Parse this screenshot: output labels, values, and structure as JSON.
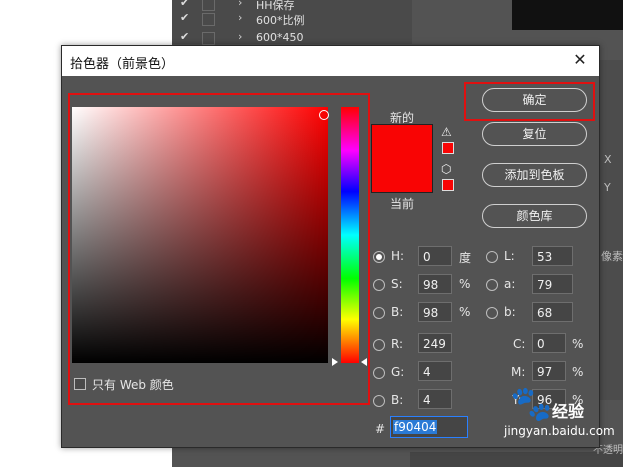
{
  "background": {
    "rows": [
      {
        "label": "HH保存",
        "check": "✔"
      },
      {
        "label": "600*比例",
        "check": "✔"
      },
      {
        "label": "600*450",
        "check": "✔"
      }
    ],
    "side_labels": {
      "x": "X",
      "y": "Y",
      "pixel": "像素",
      "opacity": "不透明"
    }
  },
  "dialog": {
    "title": "拾色器（前景色）",
    "close_glyph": "✕",
    "web_only_label": "只有 Web 颜色",
    "new_label": "新的",
    "current_label": "当前",
    "buttons": {
      "ok": "确定",
      "reset": "复位",
      "add_to_swatches": "添加到色板",
      "color_libraries": "颜色库"
    },
    "fields": {
      "H": {
        "label": "H:",
        "value": "0",
        "unit": "度"
      },
      "S": {
        "label": "S:",
        "value": "98",
        "unit": "%"
      },
      "Bv": {
        "label": "B:",
        "value": "98",
        "unit": "%"
      },
      "L": {
        "label": "L:",
        "value": "53"
      },
      "a": {
        "label": "a:",
        "value": "79"
      },
      "b": {
        "label": "b:",
        "value": "68"
      },
      "R": {
        "label": "R:",
        "value": "249"
      },
      "G": {
        "label": "G:",
        "value": "4"
      },
      "Bc": {
        "label": "B:",
        "value": "4"
      },
      "C": {
        "label": "C:",
        "value": "0",
        "unit": "%"
      },
      "M": {
        "label": "M:",
        "value": "97",
        "unit": "%"
      },
      "Y": {
        "label": "Y:",
        "value": "96",
        "unit": "%"
      }
    },
    "hash": "#",
    "hex": "f90404",
    "swatch_color": "#f90404",
    "warning_glyph": "⚠",
    "cube_glyph": "⬡"
  },
  "watermark": {
    "paw": "🐾",
    "name": "经验",
    "domain": "jingyan.baidu.com"
  }
}
